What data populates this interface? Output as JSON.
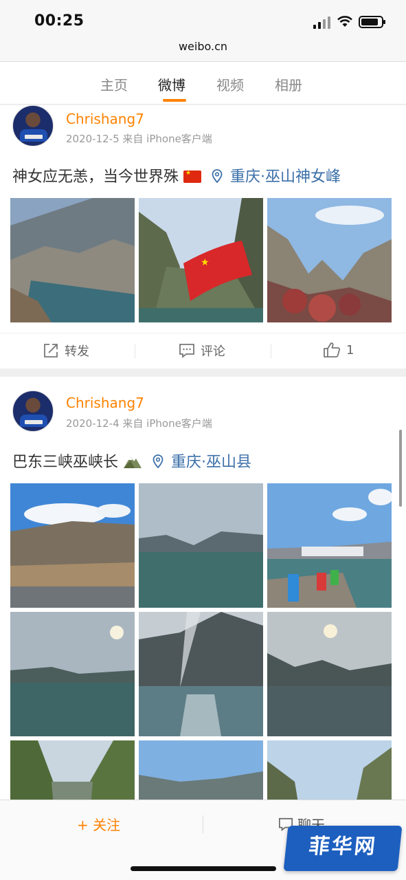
{
  "status": {
    "time": "00:25"
  },
  "browser": {
    "url": "weibo.cn"
  },
  "tabs": [
    {
      "label": "主页",
      "active": false
    },
    {
      "label": "微博",
      "active": true
    },
    {
      "label": "视频",
      "active": false
    },
    {
      "label": "相册",
      "active": false
    }
  ],
  "posts": [
    {
      "username": "Chrishang7",
      "meta": "2020-12-5 来自 iPhone客户端",
      "text": "神女应无恙，当今世界殊",
      "text_icon": "china-flag-icon",
      "location": "重庆·巫山神女峰",
      "photos": 3,
      "actions": {
        "repost": "转发",
        "comment": "评论",
        "like_count": "1"
      }
    },
    {
      "username": "Chrishang7",
      "meta": "2020-12-4 来自 iPhone客户端",
      "text": "巴东三峡巫峡长",
      "text_icon": "mountain-emoji-icon",
      "location": "重庆·巫山县",
      "photos": 9
    }
  ],
  "bottom_bar": {
    "follow": "关注",
    "chat": "聊天"
  },
  "watermark": "菲华网",
  "colors": {
    "accent": "#ff8200",
    "link": "#3b6fa8",
    "text": "#333333",
    "muted": "#999999"
  }
}
